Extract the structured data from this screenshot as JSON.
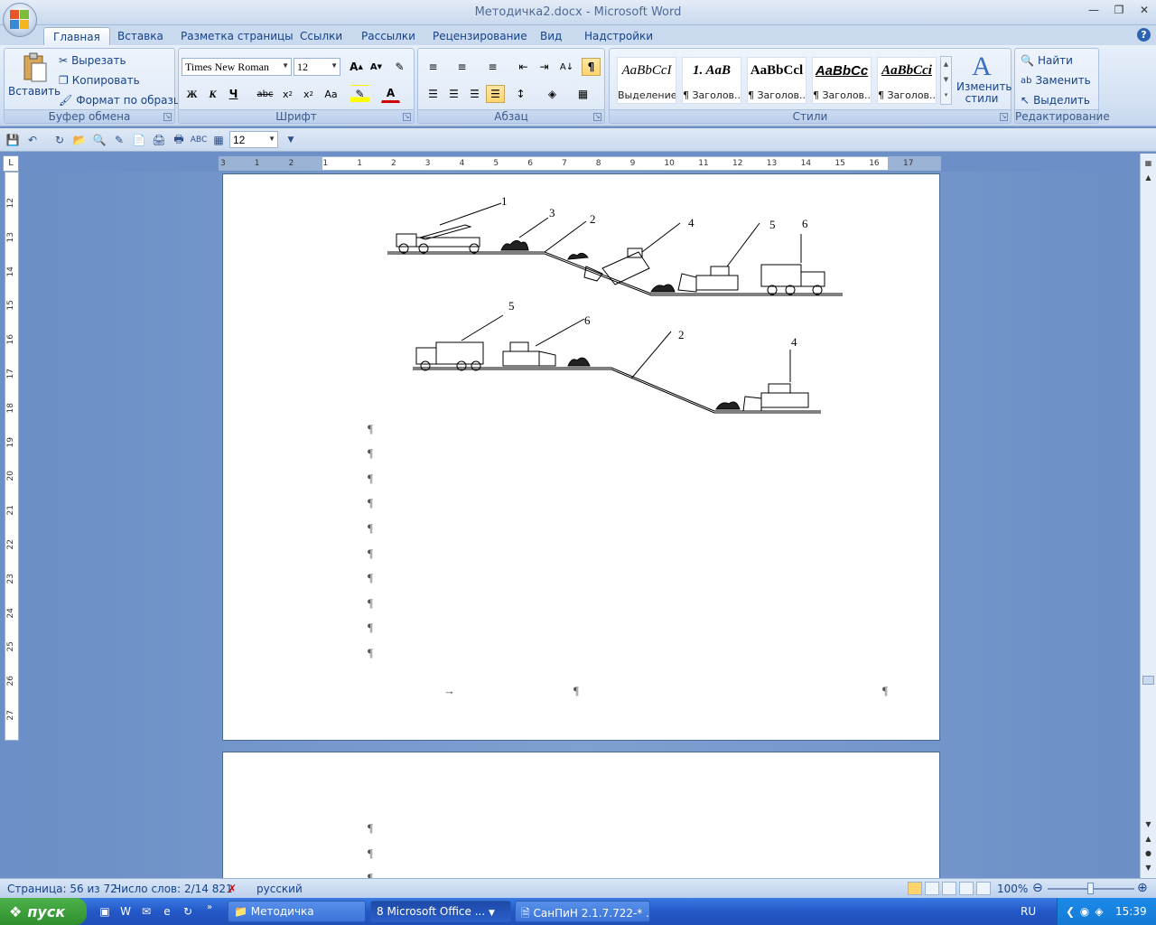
{
  "window": {
    "title": "Методичка2.docx - Microsoft Word"
  },
  "tabs": [
    "Главная",
    "Вставка",
    "Разметка страницы",
    "Ссылки",
    "Рассылки",
    "Рецензирование",
    "Вид",
    "Надстройки"
  ],
  "clipboard": {
    "paste": "Вставить",
    "cut": "Вырезать",
    "copy": "Копировать",
    "format_painter": "Формат по образцу",
    "label": "Буфер обмена"
  },
  "font": {
    "name": "Times New Roman",
    "size": "12",
    "label": "Шрифт"
  },
  "paragraph": {
    "label": "Абзац"
  },
  "styles": {
    "label": "Стили",
    "items": [
      {
        "sample": "AaBbCcI",
        "name": "Выделение"
      },
      {
        "sample": "1. AaB",
        "name": "¶ Заголов..."
      },
      {
        "sample": "AaBbCcl",
        "name": "¶ Заголов..."
      },
      {
        "sample": "AaBbCc",
        "name": "¶ Заголов..."
      },
      {
        "sample": "AaBbCci",
        "name": "¶ Заголов..."
      }
    ],
    "change": "Изменить стили"
  },
  "editing": {
    "find": "Найти",
    "replace": "Заменить",
    "select": "Выделить",
    "label": "Редактирование"
  },
  "qat": {
    "zoom_value": "12"
  },
  "ruler": {
    "h_ticks": [
      "3",
      "1",
      "2",
      "1",
      "1",
      "2",
      "3",
      "4",
      "5",
      "6",
      "7",
      "8",
      "9",
      "10",
      "11",
      "12",
      "13",
      "14",
      "15",
      "16",
      "17"
    ],
    "v_ticks": [
      "12",
      "13",
      "14",
      "15",
      "16",
      "17",
      "18",
      "19",
      "20",
      "21",
      "22",
      "23",
      "24",
      "25",
      "26",
      "27"
    ]
  },
  "figure": {
    "top_labels": [
      "1",
      "3",
      "2",
      "4",
      "5",
      "6"
    ],
    "bottom_labels": [
      "5",
      "6",
      "2",
      "4"
    ]
  },
  "marks": {
    "pilcrow": "¶",
    "tab_arrow": "→"
  },
  "status": {
    "page": "Страница: 56 из 72",
    "words": "Число слов: 2/14 821",
    "lang": "русский",
    "zoom": "100%"
  },
  "taskbar": {
    "start": "пуск",
    "items": [
      "Методичка",
      "8 Microsoft Office ...",
      "СанПиН 2.1.7.722-* ..."
    ],
    "lang": "RU",
    "clock": "15:39"
  }
}
